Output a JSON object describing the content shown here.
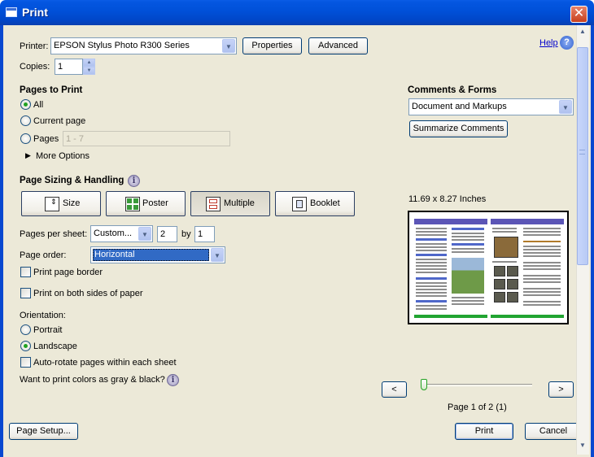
{
  "window": {
    "title": "Print",
    "close_glyph": "✕"
  },
  "header": {
    "printer_label": "Printer:",
    "printer_value": "EPSON Stylus Photo R300 Series",
    "properties_label": "Properties",
    "advanced_label": "Advanced",
    "help_label": "Help",
    "copies_label": "Copies:",
    "copies_value": "1"
  },
  "pages_to_print": {
    "heading": "Pages to Print",
    "all_label": "All",
    "current_label": "Current page",
    "pages_label": "Pages",
    "pages_placeholder": "1 - 7",
    "more_options_label": "More Options",
    "selected": "All"
  },
  "sizing": {
    "heading": "Page Sizing & Handling",
    "buttons": [
      {
        "label": "Size",
        "icon": "size-icon"
      },
      {
        "label": "Poster",
        "icon": "poster-icon"
      },
      {
        "label": "Multiple",
        "icon": "multiple-icon"
      },
      {
        "label": "Booklet",
        "icon": "booklet-icon"
      }
    ],
    "active": "Multiple",
    "pages_per_sheet_label": "Pages per sheet:",
    "pages_per_sheet_value": "Custom...",
    "cols_value": "2",
    "by_label": "by",
    "rows_value": "1",
    "page_order_label": "Page order:",
    "page_order_value": "Horizontal",
    "print_border_label": "Print page border",
    "both_sides_label": "Print on both sides of paper"
  },
  "orientation": {
    "heading": "Orientation:",
    "portrait_label": "Portrait",
    "landscape_label": "Landscape",
    "selected": "Landscape",
    "autorotate_label": "Auto-rotate pages within each sheet",
    "gray_label": "Want to print colors as gray & black?"
  },
  "comments": {
    "heading": "Comments & Forms",
    "value": "Document and Markups",
    "summarize_label": "Summarize Comments"
  },
  "preview": {
    "size_label": "11.69 x 8.27 Inches",
    "prev_glyph": "<",
    "next_glyph": ">",
    "page_status": "Page 1 of 2 (1)",
    "slider_position": 0
  },
  "footer": {
    "page_setup_label": "Page Setup...",
    "print_label": "Print",
    "cancel_label": "Cancel"
  },
  "colors": {
    "titlebar": "#0050d8",
    "dialog_bg": "#ece9d8",
    "radio_dot": "#21a121",
    "page_order_highlight": "#316ac5"
  }
}
